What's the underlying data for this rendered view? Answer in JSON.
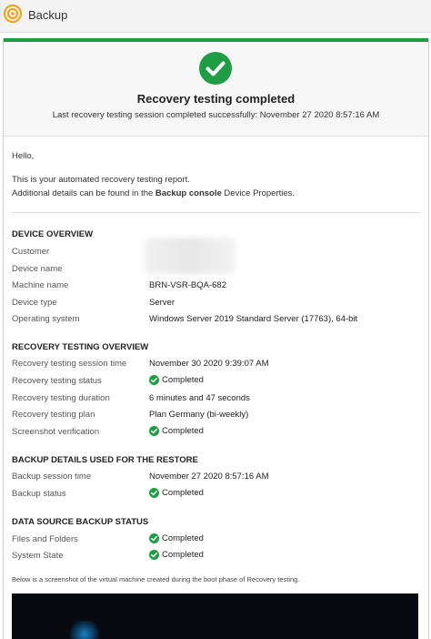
{
  "app": {
    "title": "Backup"
  },
  "header": {
    "title": "Recovery testing completed",
    "subtitle": "Last recovery testing session completed successfully: November 27 2020 8:57:16 AM"
  },
  "intro": {
    "greeting": "Hello,",
    "line1": "This is your automated recovery testing report.",
    "line2_prefix": "Additional details can be found in the ",
    "line2_bold": "Backup console",
    "line2_suffix": " Device Properties."
  },
  "device_overview": {
    "title": "DEVICE OVERVIEW",
    "rows": [
      {
        "label": "Customer",
        "value": ""
      },
      {
        "label": "Device name",
        "value": ""
      },
      {
        "label": "Machine name",
        "value": "BRN-VSR-BQA-682"
      },
      {
        "label": "Device type",
        "value": "Server"
      },
      {
        "label": "Operating system",
        "value": "Windows Server 2019 Standard Server (17763), 64-bit"
      }
    ]
  },
  "recovery_overview": {
    "title": "RECOVERY TESTING OVERVIEW",
    "rows": [
      {
        "label": "Recovery testing session time",
        "value": "November 30 2020 9:39:07 AM"
      },
      {
        "label": "Recovery testing status",
        "value": "Completed"
      },
      {
        "label": "Recovery testing duration",
        "value": "6 minutes and 47 seconds"
      },
      {
        "label": "Recovery testing plan",
        "value": "Plan Germany (bi-weekly)"
      },
      {
        "label": "Screenshot verification",
        "value": "Completed"
      }
    ]
  },
  "backup_details": {
    "title": "BACKUP DETAILS USED FOR THE RESTORE",
    "rows": [
      {
        "label": "Backup session time",
        "value": "November 27 2020 8:57:16 AM"
      },
      {
        "label": "Backup status",
        "value": "Completed"
      }
    ]
  },
  "data_source": {
    "title": "DATA SOURCE BACKUP STATUS",
    "rows": [
      {
        "label": "Files and Folders",
        "value": "Completed"
      },
      {
        "label": "System State",
        "value": "Completed"
      }
    ]
  },
  "footer": {
    "note": "Below is a screenshot of the virtual machine created during the boot phase of Recovery testing."
  },
  "colors": {
    "success": "#1f9d44",
    "logo": "#f5a31a"
  },
  "icons": {
    "logo": "backup-logo-icon",
    "status": "check-circle-icon"
  }
}
